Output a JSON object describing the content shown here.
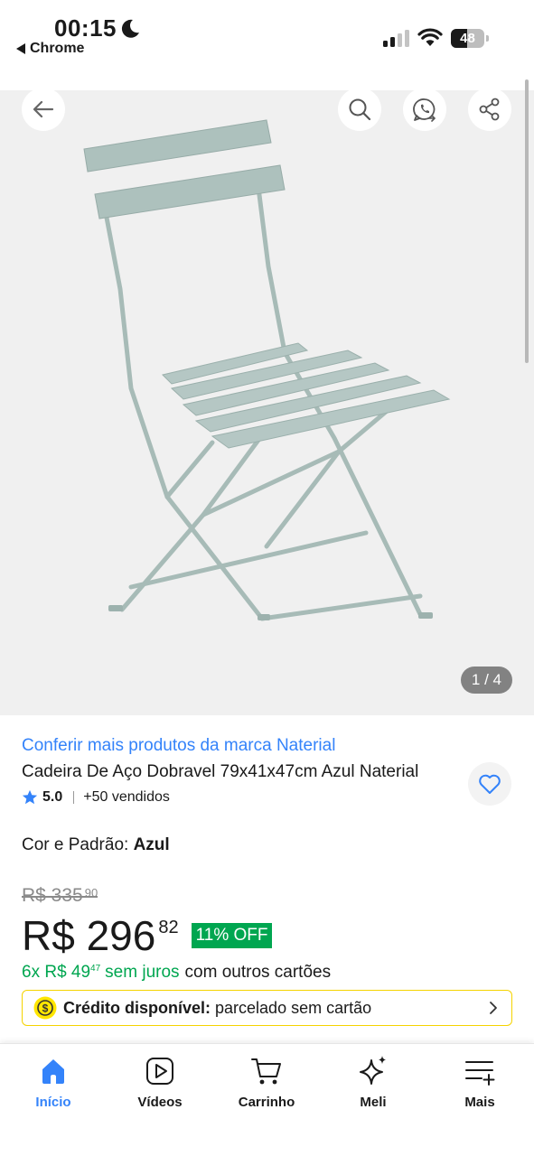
{
  "status_bar": {
    "time": "00:15",
    "back_app": "Chrome",
    "battery_level": "48",
    "icons": [
      "moon-icon",
      "signal-icon",
      "wifi-icon",
      "battery-icon"
    ]
  },
  "gallery": {
    "image_description": "blue folding steel chair",
    "counter": "1 / 4",
    "icons": [
      "back-arrow-icon",
      "search-icon",
      "whatsapp-share-icon",
      "share-icon"
    ]
  },
  "product": {
    "brand_link": "Conferir mais produtos da marca Naterial",
    "title": "Cadeira De Aço Dobravel 79x41x47cm Azul Naterial",
    "rating": "5.0",
    "sold": "+50 vendidos",
    "variant_label": "Cor e Padrão: ",
    "variant_value": "Azul"
  },
  "pricing": {
    "old_price": "R$ 335",
    "old_cents": "90",
    "price": "R$ 296",
    "price_cents": "82",
    "discount": "11% OFF",
    "installments_prefix": "6x R$ 49",
    "installments_cents": "47",
    "installments_green_suffix": "sem juros",
    "installments_rest": "com outros cartões"
  },
  "credit": {
    "label": "Crédito disponível:",
    "text": "parcelado sem cartão"
  },
  "nav": {
    "items": [
      {
        "label": "Início",
        "icon": "home-icon",
        "active": true
      },
      {
        "label": "Vídeos",
        "icon": "video-icon",
        "active": false
      },
      {
        "label": "Carrinho",
        "icon": "cart-icon",
        "active": false
      },
      {
        "label": "Meli",
        "icon": "sparkle-icon",
        "active": false
      },
      {
        "label": "Mais",
        "icon": "menu-plus-icon",
        "active": false
      }
    ]
  },
  "colors": {
    "accent_blue": "#3483fa",
    "discount_green": "#00a650",
    "credit_border": "#f5d300"
  }
}
